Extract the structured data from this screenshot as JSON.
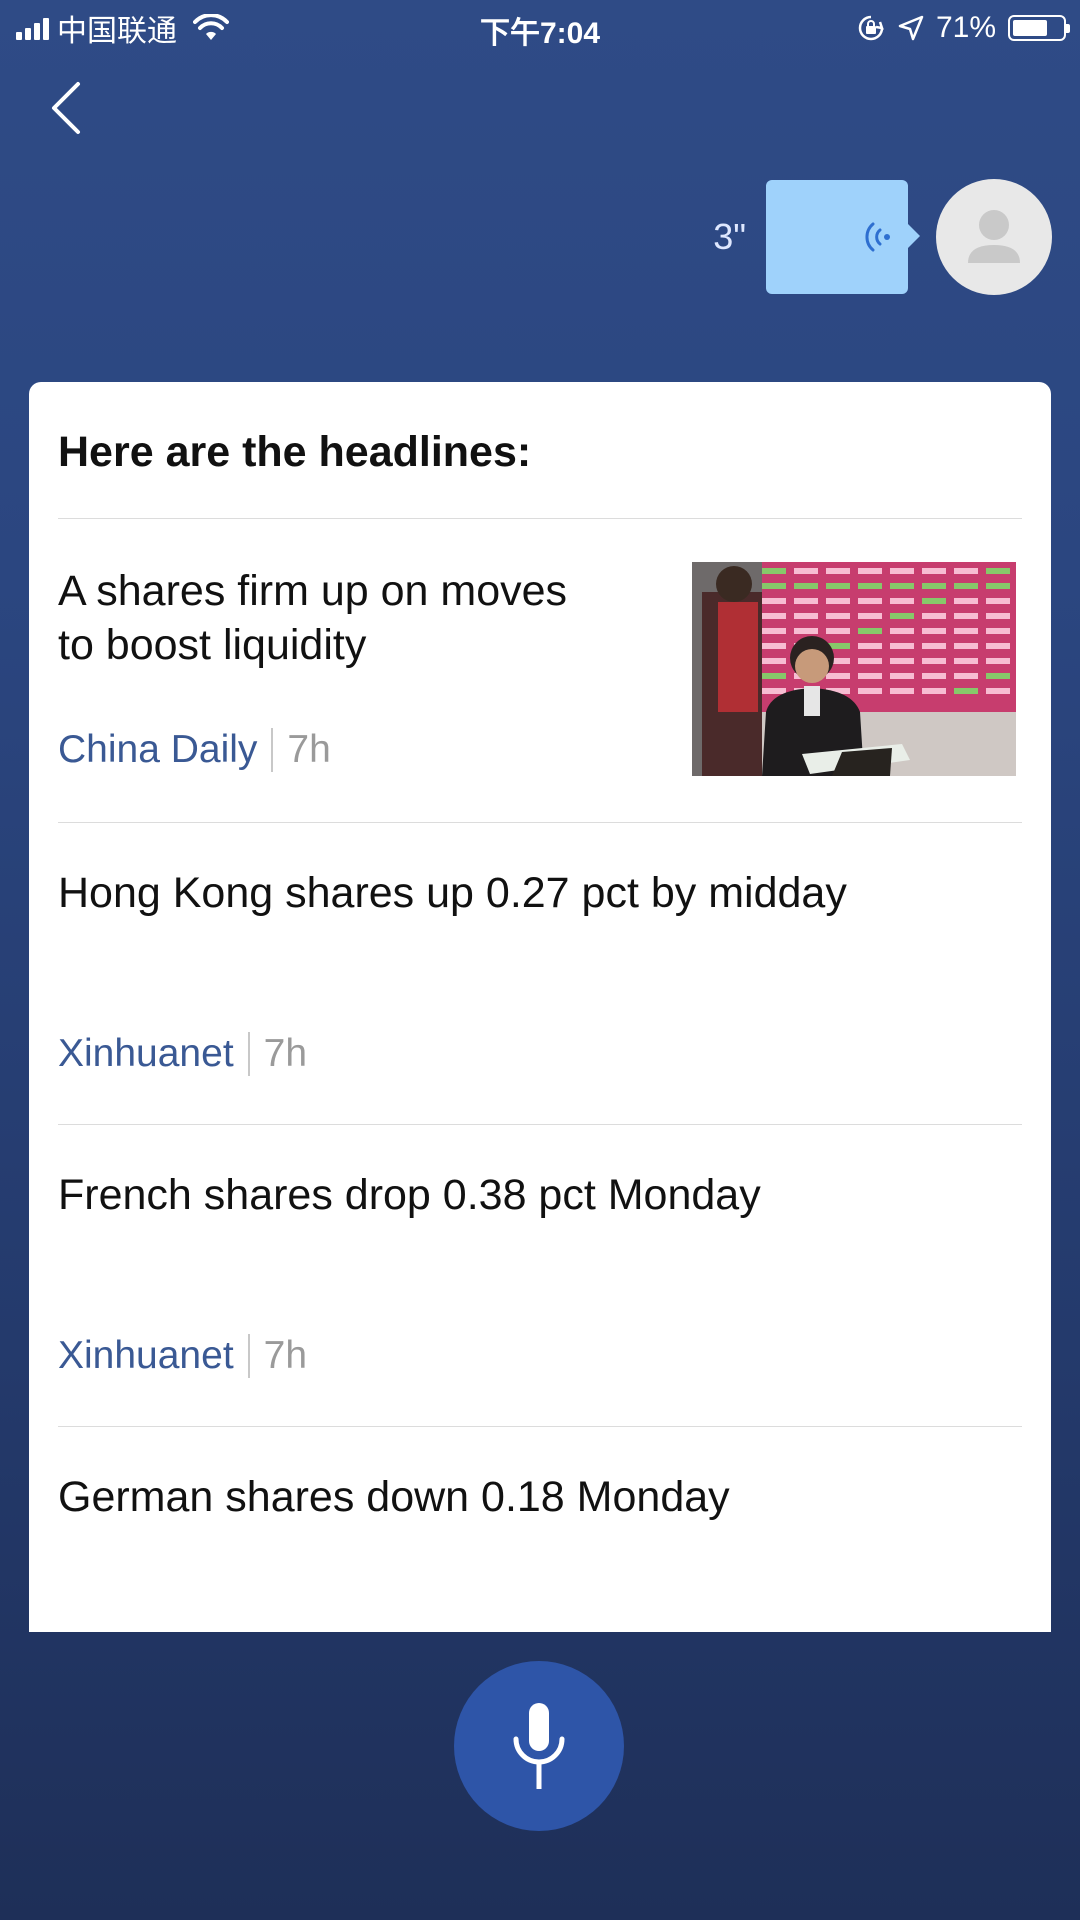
{
  "status_bar": {
    "carrier": "中国联通",
    "time": "下午7:04",
    "battery_percent": "71%",
    "battery_level": 0.71,
    "signal_icon": "signal-bars-icon",
    "wifi_icon": "wifi-icon",
    "orientation_lock_icon": "orientation-lock-icon",
    "location_icon": "location-arrow-icon"
  },
  "header": {
    "back_icon": "chevron-left-icon"
  },
  "voice_message": {
    "duration": "3\"",
    "icon": "voice-wave-icon",
    "bubble_color": "#9fd2fb"
  },
  "avatar": {
    "icon": "user-silhouette-icon"
  },
  "card": {
    "title": "Here are the headlines:",
    "items": [
      {
        "headline_line1": "A shares firm up on moves",
        "headline_line2": "to boost liquidity",
        "source": "China Daily",
        "age": "7h",
        "has_image": true
      },
      {
        "headline": "Hong Kong shares up 0.27 pct by midday",
        "source": "Xinhuanet",
        "age": "7h"
      },
      {
        "headline": "French shares drop 0.38 pct Monday",
        "source": "Xinhuanet",
        "age": "7h"
      },
      {
        "headline": "German shares down 0.18 Monday"
      }
    ]
  },
  "mic": {
    "icon": "microphone-icon",
    "color": "#2e55a8"
  },
  "colors": {
    "source_link": "#3a5994",
    "age_text": "#9a9a9a",
    "background_top": "#2f4b86",
    "background_bottom": "#1e2f58"
  }
}
